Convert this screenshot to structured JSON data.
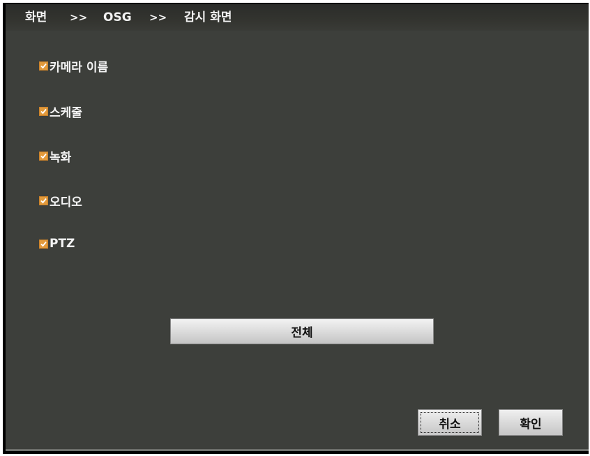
{
  "breadcrumb": {
    "items": [
      "화면",
      "OSG",
      "감시 화면"
    ],
    "separator": ">>"
  },
  "options": [
    {
      "label": "카메라 이름",
      "checked": true
    },
    {
      "label": "스케줄",
      "checked": true
    },
    {
      "label": "녹화",
      "checked": true
    },
    {
      "label": "오디오",
      "checked": true
    },
    {
      "label": "PTZ",
      "checked": true
    }
  ],
  "buttons": {
    "all_label": "전체",
    "cancel_label": "취소",
    "ok_label": "확인"
  },
  "colors": {
    "background": "#3d3f3b",
    "checkbox_accent": "#e29a3c"
  }
}
